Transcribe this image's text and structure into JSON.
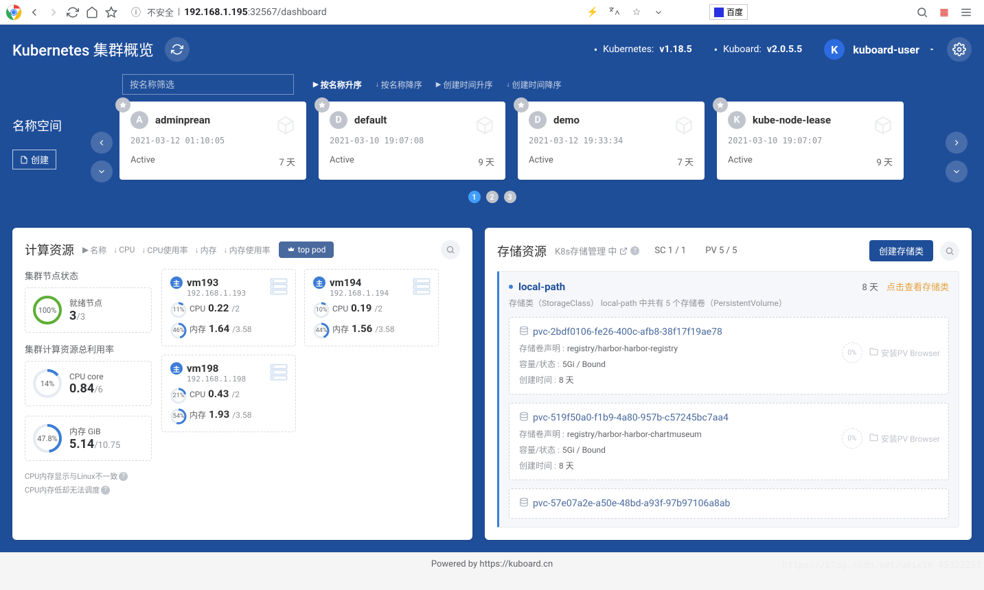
{
  "browser": {
    "insecure": "不安全",
    "url_host": "192.168.1.195",
    "url_port_path": ":32567/dashboard",
    "search_engine": "百度"
  },
  "header": {
    "title": "Kubernetes 集群概览",
    "k8s_label": "Kubernetes:",
    "k8s_version": "v1.18.5",
    "kuboard_label": "Kuboard:",
    "kuboard_version": "v2.0.5.5",
    "user_initial": "K",
    "user_name": "kuboard-user"
  },
  "namespaces": {
    "section_label": "名称空间",
    "create_label": "创建",
    "filter_placeholder": "按名称筛选",
    "sort_opts": [
      "按名称升序",
      "按名称降序",
      "创建时间升序",
      "创建时间降序"
    ],
    "cards": [
      {
        "letter": "A",
        "name": "adminprean",
        "time": "2021-03-12 01:10:05",
        "status": "Active",
        "age": "7 天"
      },
      {
        "letter": "D",
        "name": "default",
        "time": "2021-03-10 19:07:08",
        "status": "Active",
        "age": "9 天"
      },
      {
        "letter": "D",
        "name": "demo",
        "time": "2021-03-12 19:33:34",
        "status": "Active",
        "age": "7 天"
      },
      {
        "letter": "K",
        "name": "kube-node-lease",
        "time": "2021-03-10 19:07:07",
        "status": "Active",
        "age": "9 天"
      }
    ],
    "pages": [
      "1",
      "2",
      "3"
    ]
  },
  "compute": {
    "title": "计算资源",
    "sort": [
      "名称",
      "CPU",
      "CPU使用率",
      "内存",
      "内存使用率"
    ],
    "top_pod": "top pod",
    "cluster_node_label": "集群节点状态",
    "ready_label": "就绪节点",
    "ready_pct": "100%",
    "ready_num": "3",
    "ready_den": "/3",
    "util_label": "集群计算资源总利用率",
    "cpu_label": "CPU core",
    "cpu_pct": "14%",
    "cpu_num": "0.84",
    "cpu_den": "/6",
    "mem_label": "内存 GiB",
    "mem_pct": "47.8%",
    "mem_num": "5.14",
    "mem_den": "/10.75",
    "note1": "CPU内存显示与Linux不一致",
    "note2": "CPU内存低却无法调度",
    "nodes": [
      {
        "name": "vm193",
        "ip": "192.168.1.193",
        "cpu_pct": "11%",
        "cpu_val": "0.22",
        "cpu_den": "/2",
        "mem_pct": "46%",
        "mem_val": "1.64",
        "mem_den": "/3.58"
      },
      {
        "name": "vm194",
        "ip": "192.168.1.194",
        "cpu_pct": "10%",
        "cpu_val": "0.19",
        "cpu_den": "/2",
        "mem_pct": "44%",
        "mem_val": "1.56",
        "mem_den": "/3.58"
      },
      {
        "name": "vm198",
        "ip": "192.168.1.198",
        "cpu_pct": "21%",
        "cpu_val": "0.43",
        "cpu_den": "/2",
        "mem_pct": "54%",
        "mem_val": "1.93",
        "mem_den": "/3.58"
      }
    ]
  },
  "storage": {
    "title": "存储资源",
    "sub_label": "K8s存储管理 中",
    "sc_count": "SC 1 / 1",
    "pv_count": "PV 5 / 5",
    "create_label": "创建存储类",
    "sc_name": "local-path",
    "sc_age": "8 天",
    "sc_link": "点击查看存储类",
    "sc_desc": "存储类（StorageClass） local-path 中共有 5 个存储卷（PersistentVolume）",
    "pv_pct": "0%",
    "install_label": "安装PV Browser",
    "claim_label": "存储卷声明 :",
    "cap_label": "容量/状态 :",
    "created_label": "创建时间 :",
    "pvs": [
      {
        "name": "pvc-2bdf0106-fe26-400c-afb8-38f17f19ae78",
        "claim": "registry/harbor-harbor-registry",
        "cap": "5Gi / Bound",
        "created": "8 天"
      },
      {
        "name": "pvc-519f50a0-f1b9-4a80-957b-c57245bc7aa4",
        "claim": "registry/harbor-harbor-chartmuseum",
        "cap": "5Gi / Bound",
        "created": "8 天"
      },
      {
        "name": "pvc-57e07a2e-a50e-48bd-a93f-97b97106a8ab",
        "claim": "",
        "cap": "",
        "created": ""
      }
    ]
  },
  "footer": {
    "powered": "Powered by ",
    "link": "https://kuboard.cn"
  },
  "watermark": "https://blog.csdn.net/weixin_45322253"
}
